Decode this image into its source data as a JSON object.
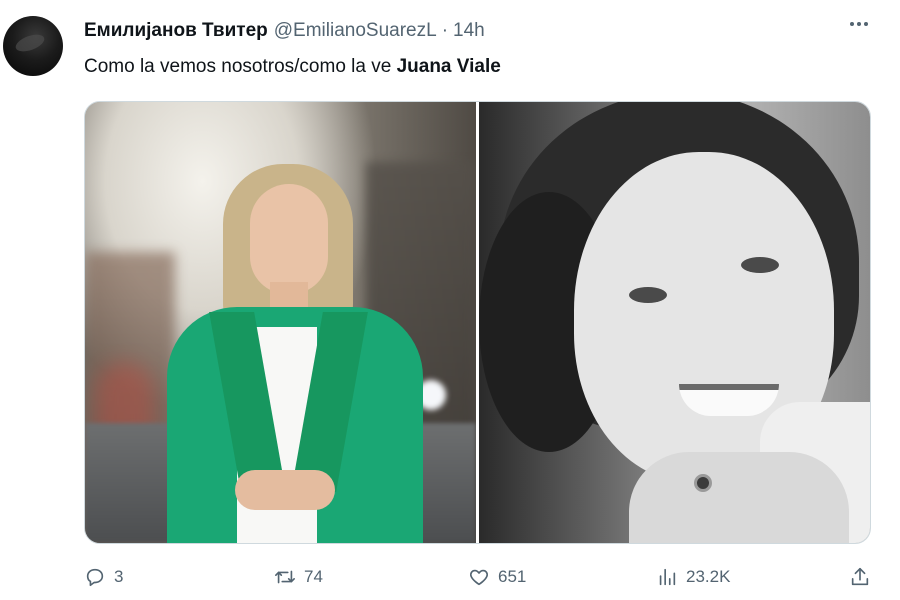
{
  "tweet": {
    "display_name": "Емилијанов Твитер",
    "handle": "@EmilianoSuarezL",
    "separator": "·",
    "time": "14h",
    "text_main": "Como la vemos nosotros/como la ve ",
    "text_bold": "Juana Viale"
  },
  "actions": {
    "replies": "3",
    "retweets": "74",
    "likes": "651",
    "views": "23.2K"
  },
  "icons": {
    "reply": "reply-icon",
    "retweet": "retweet-icon",
    "like": "heart-icon",
    "views": "analytics-icon",
    "share": "share-icon",
    "more": "more-icon"
  },
  "colors": {
    "text": "#0f1419",
    "secondary": "#536471",
    "border": "#cfd9de",
    "blazer": "#1aa774"
  }
}
